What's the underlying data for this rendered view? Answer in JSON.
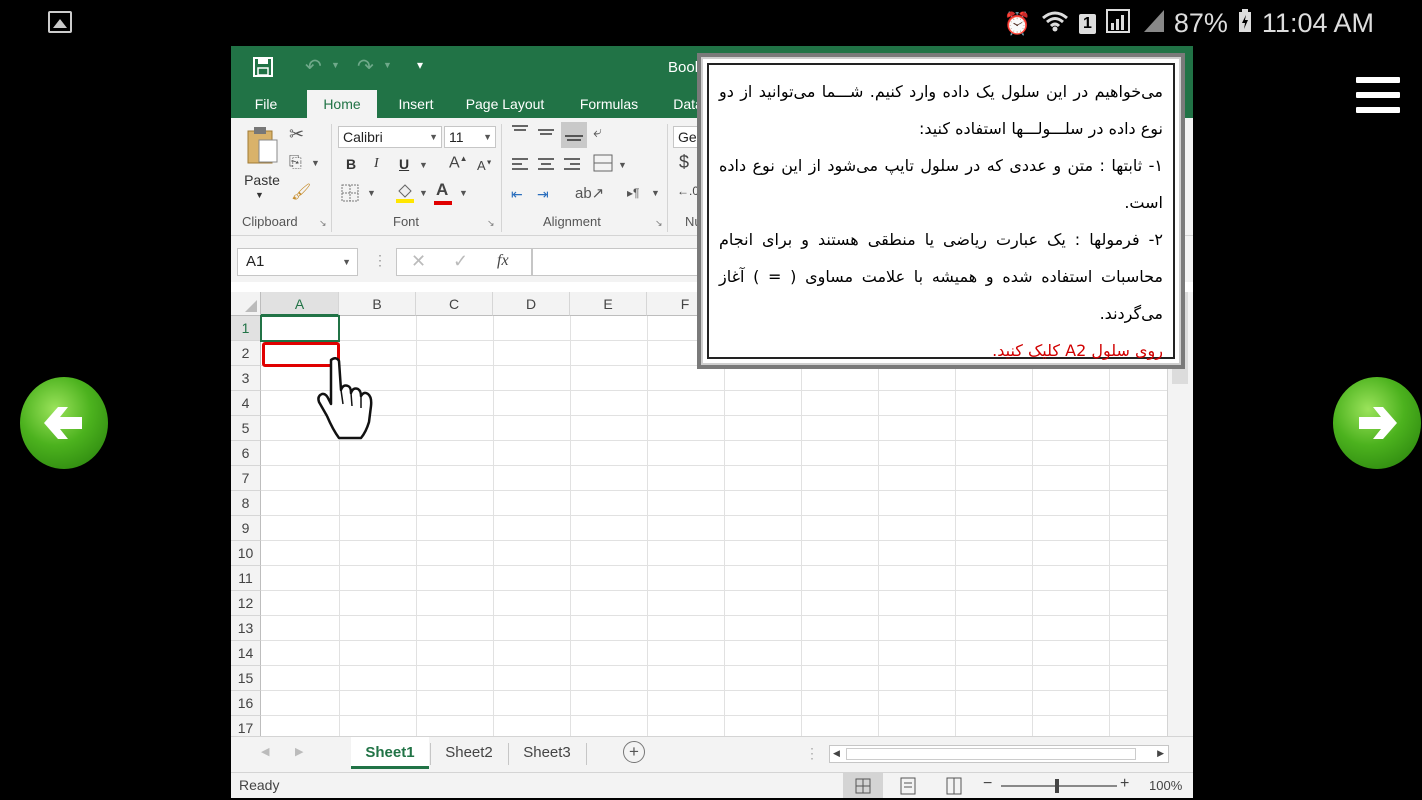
{
  "status_bar": {
    "battery": "87%",
    "time": "11:04 AM",
    "sim_badge": "1"
  },
  "excel": {
    "title": "Book",
    "tabs": [
      "File",
      "Home",
      "Insert",
      "Page Layout",
      "Formulas",
      "Data"
    ],
    "active_tab": "Home",
    "clipboard": {
      "paste_label": "Paste",
      "group_label": "Clipboard"
    },
    "font": {
      "family": "Calibri",
      "size": "11",
      "group_label": "Font",
      "bold": "B",
      "italic": "I",
      "underline": "U"
    },
    "alignment": {
      "group_label": "Alignment"
    },
    "number": {
      "format": "Ger",
      "group_label": "Nu",
      "currency": "$"
    },
    "name_box": "A1",
    "fx_label": "fx",
    "columns": [
      "A",
      "B",
      "C",
      "D",
      "E",
      "F"
    ],
    "rows": [
      "1",
      "2",
      "3",
      "4",
      "5",
      "6",
      "7",
      "8",
      "9",
      "10",
      "11",
      "12",
      "13",
      "14",
      "15",
      "16",
      "17"
    ],
    "sheets": [
      "Sheet1",
      "Sheet2",
      "Sheet3"
    ],
    "active_sheet": "Sheet1",
    "status_ready": "Ready",
    "zoom": "100%"
  },
  "instruction": {
    "para1": "می‌خواهیم در این سلول یک داده وارد کنیم. شـــما می‌توانید از دو نوع داده در سلـــولـــها استفاده کنید:",
    "para2": "۱- ثابتها : متن و عددی که در سلول تایپ می‌شود از این نوع داده است.",
    "para3": "۲- فرمولها : یک عبارت ریاضی یا منطقی هستند و برای انجام محاسبات استفاده شده و همیشه با علامت مساوی ( = ) آغاز می‌گردند.",
    "action": "روی سلول A2 کلیک کنید."
  },
  "colors": {
    "excel_green": "#217346",
    "highlight_red": "#e00000",
    "action_red": "#d10000"
  }
}
